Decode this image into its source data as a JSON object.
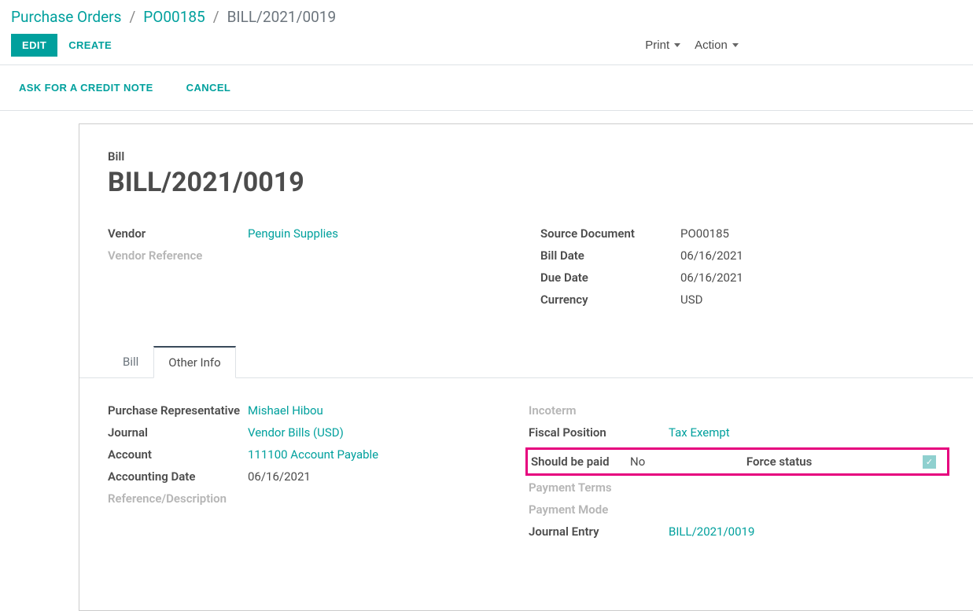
{
  "breadcrumb": {
    "root": "Purchase Orders",
    "po": "PO00185",
    "current": "BILL/2021/0019"
  },
  "toolbar": {
    "edit": "EDIT",
    "create": "CREATE",
    "print": "Print",
    "action": "Action"
  },
  "actionbar": {
    "credit_note": "ASK FOR A CREDIT NOTE",
    "cancel": "CANCEL"
  },
  "header": {
    "label": "Bill",
    "title": "BILL/2021/0019"
  },
  "fields_left_top": {
    "vendor_label": "Vendor",
    "vendor_value": "Penguin Supplies",
    "vendor_ref_label": "Vendor Reference",
    "vendor_ref_value": ""
  },
  "fields_right_top": {
    "source_label": "Source Document",
    "source_value": "PO00185",
    "billdate_label": "Bill Date",
    "billdate_value": "06/16/2021",
    "duedate_label": "Due Date",
    "duedate_value": "06/16/2021",
    "currency_label": "Currency",
    "currency_value": "USD"
  },
  "tabs": {
    "bill": "Bill",
    "other_info": "Other Info"
  },
  "other_info_left": {
    "rep_label": "Purchase Representative",
    "rep_value": "Mishael Hibou",
    "journal_label": "Journal",
    "journal_value": "Vendor Bills (USD)",
    "account_label": "Account",
    "account_value": "111100 Account Payable",
    "accdate_label": "Accounting Date",
    "accdate_value": "06/16/2021",
    "refdesc_label": "Reference/Description",
    "refdesc_value": ""
  },
  "other_info_right": {
    "incoterm_label": "Incoterm",
    "incoterm_value": "",
    "fiscal_label": "Fiscal Position",
    "fiscal_value": "Tax Exempt",
    "should_label": "Should be paid",
    "should_value": "No",
    "force_label": "Force status",
    "terms_label": "Payment Terms",
    "terms_value": "",
    "mode_label": "Payment Mode",
    "mode_value": "",
    "entry_label": "Journal Entry",
    "entry_value": "BILL/2021/0019"
  }
}
